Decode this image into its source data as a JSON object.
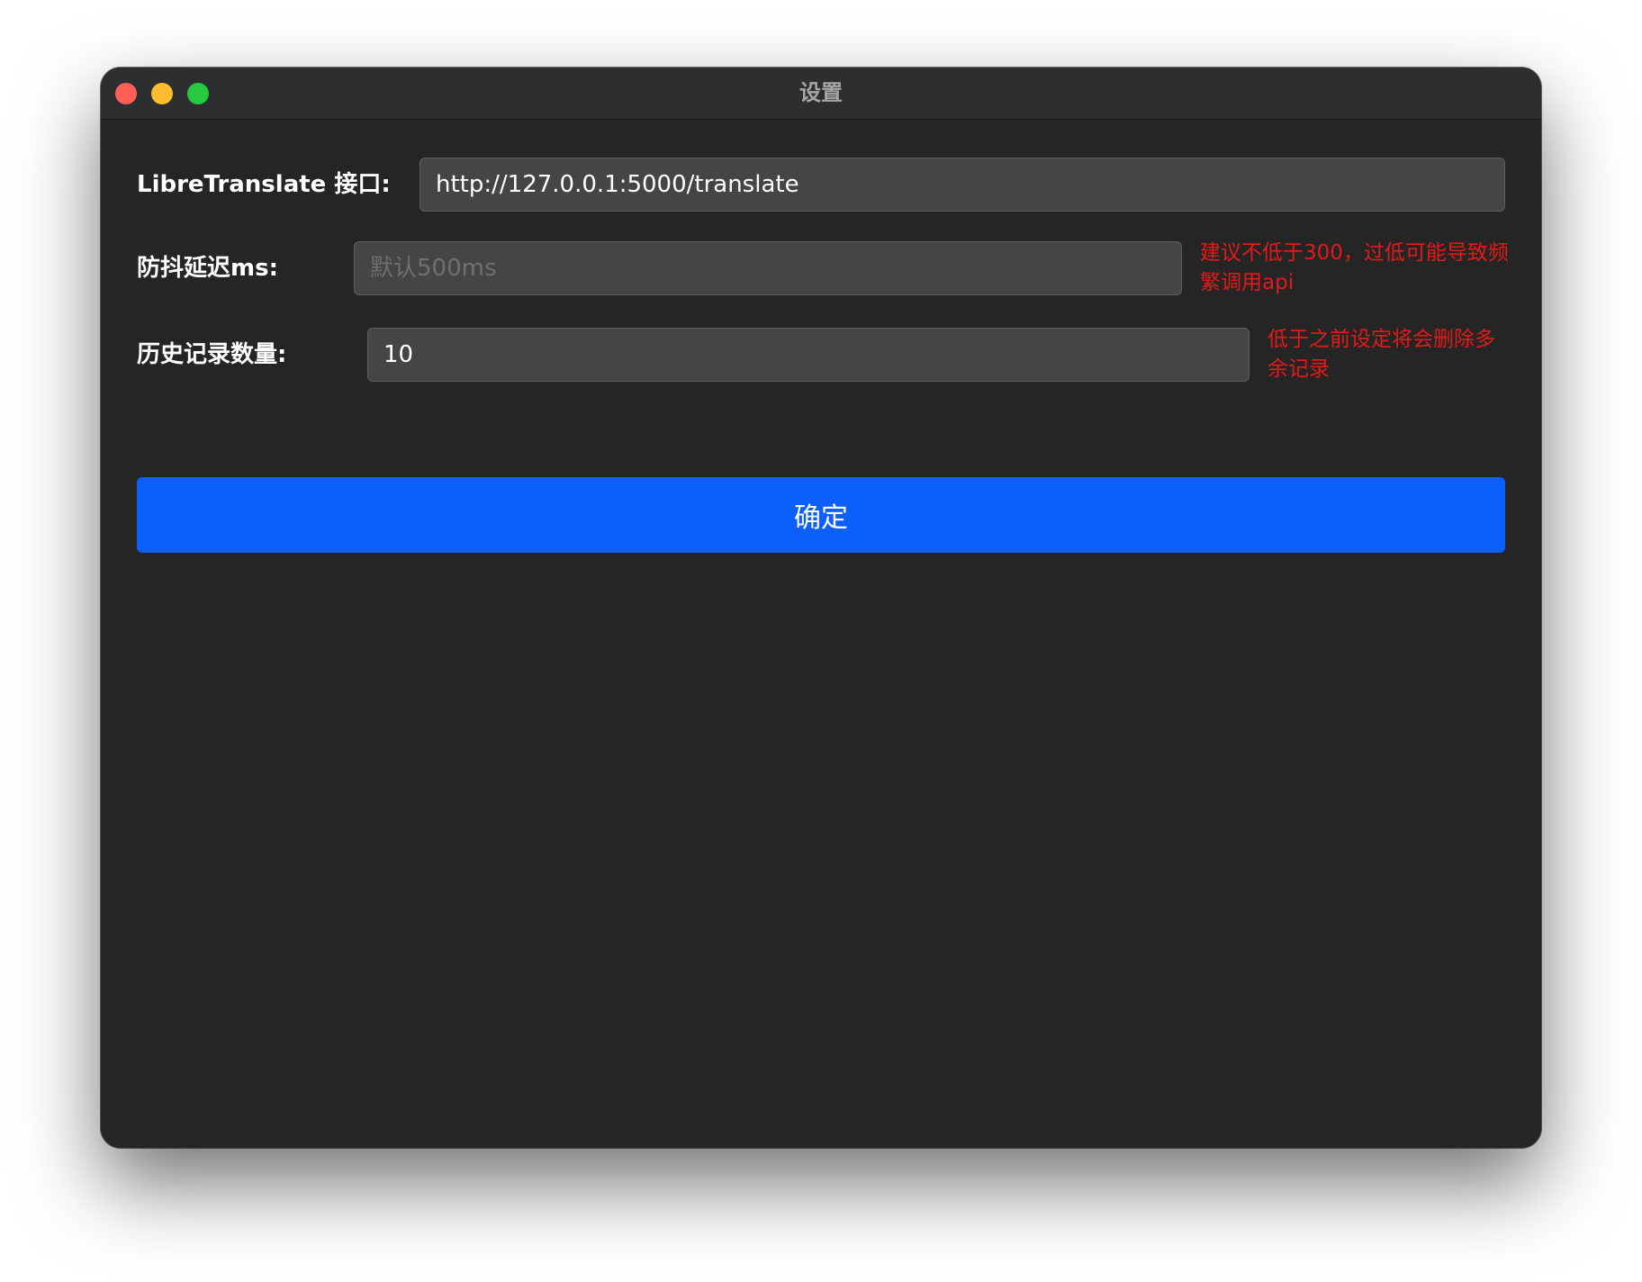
{
  "window": {
    "title": "设置"
  },
  "form": {
    "api": {
      "label": "LibreTranslate 接口:",
      "value": "http://127.0.0.1:5000/translate",
      "placeholder": ""
    },
    "debounce": {
      "label": "防抖延迟ms:",
      "value": "",
      "placeholder": "默认500ms",
      "hint": "建议不低于300，过低可能导致频繁调用api"
    },
    "history": {
      "label": "历史记录数量:",
      "value": "10",
      "placeholder": "",
      "hint": "低于之前设定将会删除多余记录"
    },
    "confirm_label": "确定"
  },
  "colors": {
    "window_bg": "#252525",
    "titlebar_bg": "#2c2e2f",
    "input_bg": "#454545",
    "accent": "#0d5ff9",
    "hint_text": "#e21a1a",
    "close": "#ff5f57",
    "minimize": "#febc2e",
    "zoom": "#28c840"
  }
}
